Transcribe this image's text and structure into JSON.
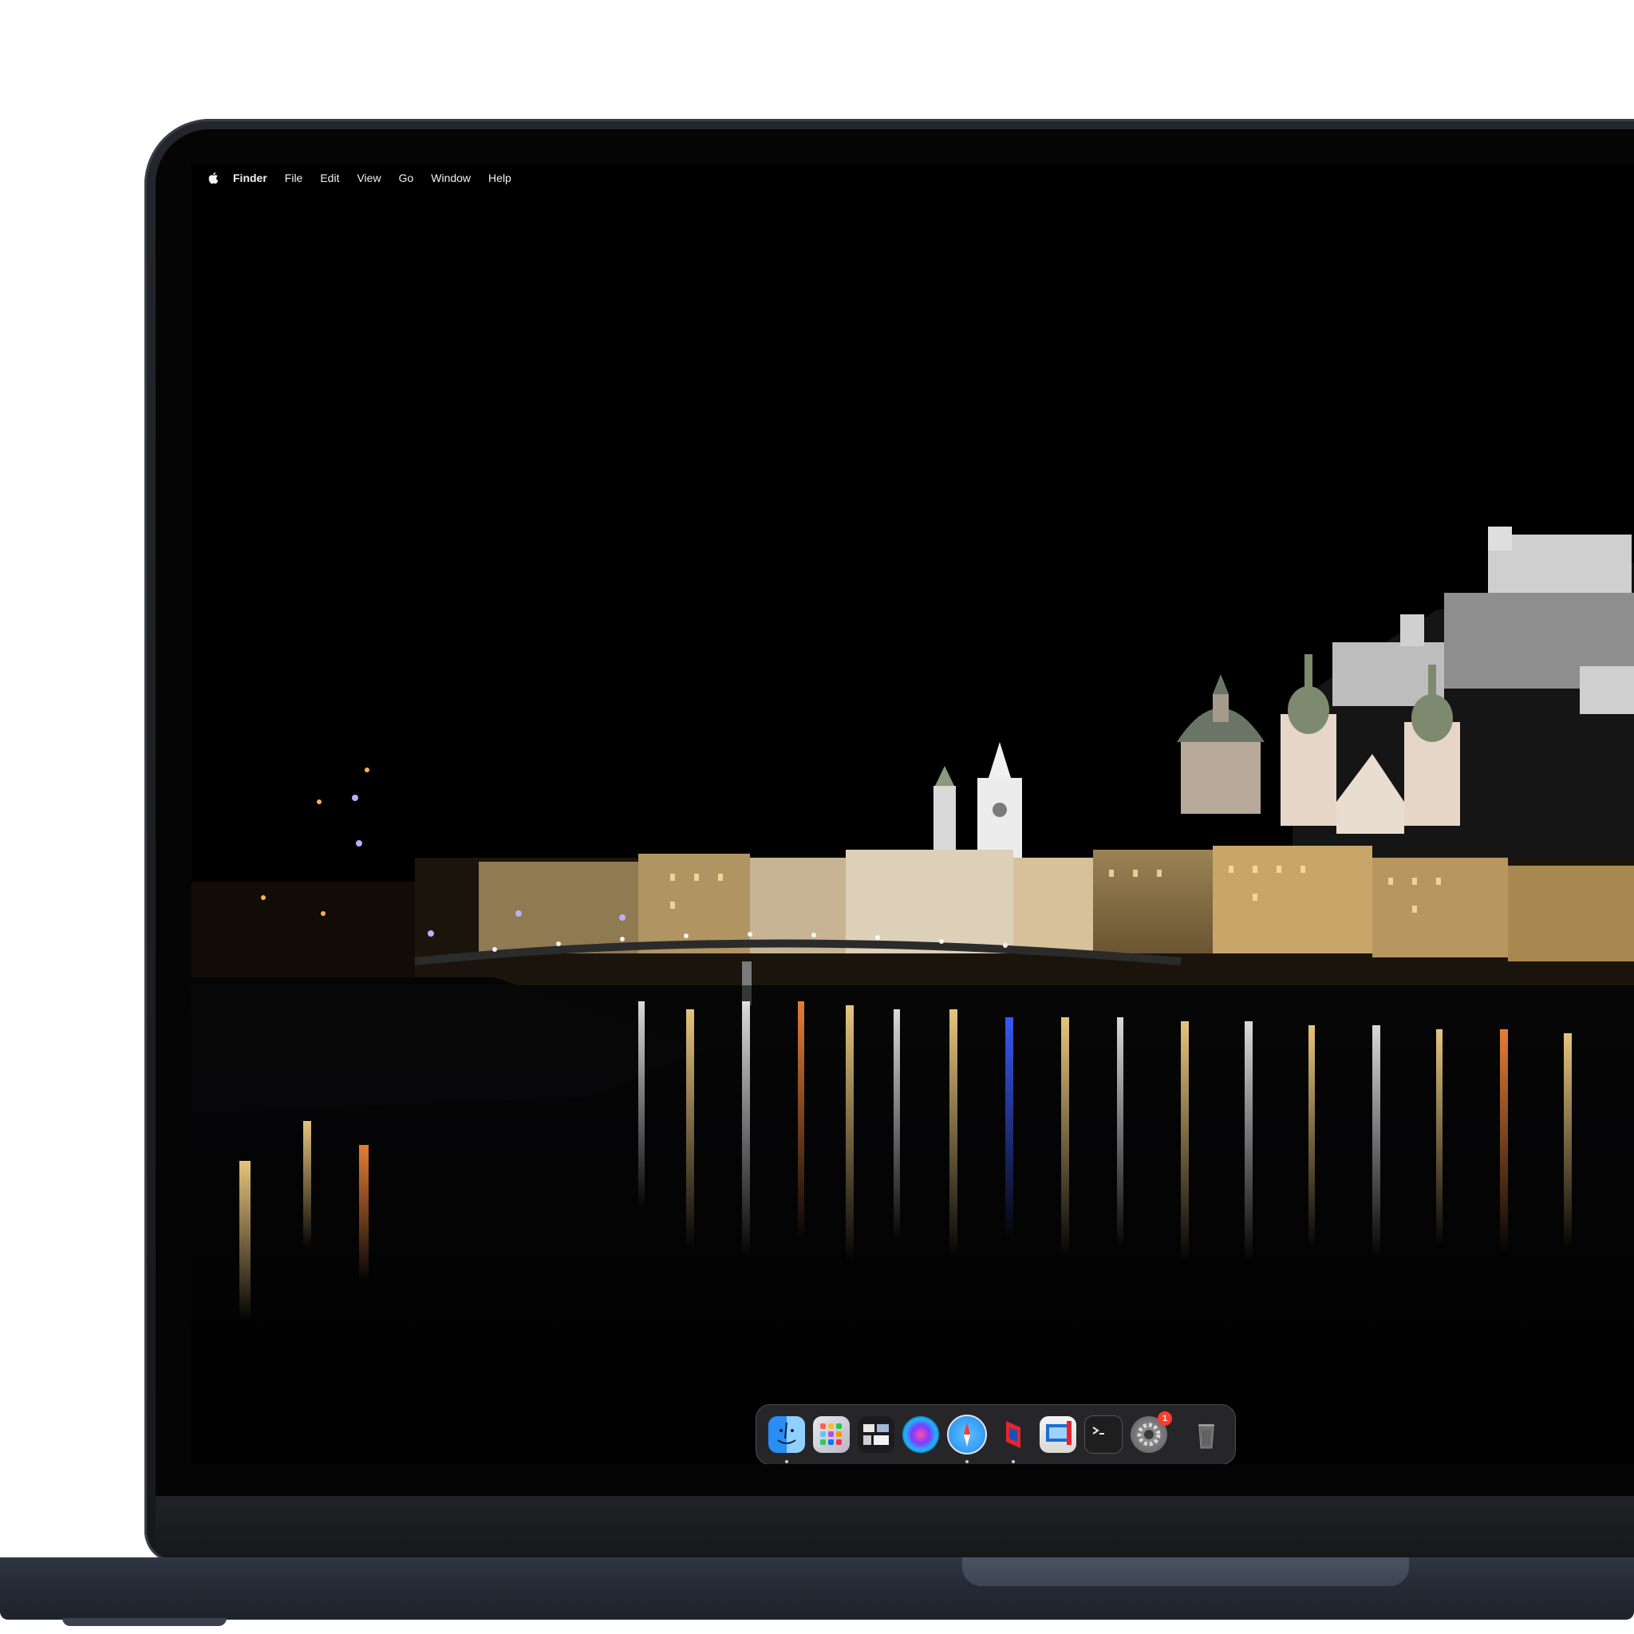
{
  "menubar": {
    "apple_icon": "apple-logo-icon",
    "items": [
      {
        "label": "Finder",
        "bold": true
      },
      {
        "label": "File"
      },
      {
        "label": "Edit"
      },
      {
        "label": "View"
      },
      {
        "label": "Go"
      },
      {
        "label": "Window"
      },
      {
        "label": "Help"
      }
    ]
  },
  "dock": {
    "apps": [
      {
        "icon": "finder-icon",
        "running": true
      },
      {
        "icon": "launchpad-icon",
        "running": false
      },
      {
        "icon": "mission-control-icon",
        "running": false
      },
      {
        "icon": "siri-icon",
        "running": false
      },
      {
        "icon": "safari-icon",
        "running": true
      },
      {
        "icon": "red-app-icon",
        "running": true
      },
      {
        "icon": "remote-desktop-icon",
        "running": false
      },
      {
        "icon": "terminal-icon",
        "running": false
      },
      {
        "icon": "system-settings-icon",
        "running": false,
        "badge": "1"
      }
    ],
    "trash_icon": "trash-icon"
  },
  "colors": {
    "menubar_text": "#f2f2f2",
    "badge": "#ff3b30",
    "safari_blue": "#1e8cf0"
  }
}
